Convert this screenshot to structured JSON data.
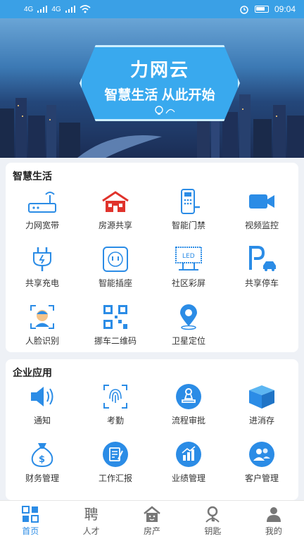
{
  "status_bar": {
    "signal_1": "4G",
    "signal_2": "4G",
    "time": "09:04"
  },
  "banner": {
    "brand": "力网云",
    "slogan": "智慧生活 从此开始"
  },
  "smart_life": {
    "title": "智慧生活",
    "items": [
      {
        "label": "力网宽带",
        "icon": "router-icon"
      },
      {
        "label": "房源共享",
        "icon": "house-icon"
      },
      {
        "label": "智能门禁",
        "icon": "door-lock-icon"
      },
      {
        "label": "视频监控",
        "icon": "camera-icon"
      },
      {
        "label": "共享充电",
        "icon": "charger-plug-icon"
      },
      {
        "label": "智能插座",
        "icon": "socket-icon"
      },
      {
        "label": "社区彩屏",
        "icon": "led-screen-icon"
      },
      {
        "label": "共享停车",
        "icon": "parking-icon"
      },
      {
        "label": "人脸识别",
        "icon": "face-scan-icon"
      },
      {
        "label": "挪车二维码",
        "icon": "qr-code-icon"
      },
      {
        "label": "卫星定位",
        "icon": "location-pin-icon"
      }
    ]
  },
  "enterprise": {
    "title": "企业应用",
    "items": [
      {
        "label": "通知",
        "icon": "speaker-icon"
      },
      {
        "label": "考勤",
        "icon": "fingerprint-icon"
      },
      {
        "label": "流程审批",
        "icon": "stamp-icon"
      },
      {
        "label": "进消存",
        "icon": "box-icon"
      },
      {
        "label": "财务管理",
        "icon": "money-bag-icon"
      },
      {
        "label": "工作汇报",
        "icon": "report-icon"
      },
      {
        "label": "业绩管理",
        "icon": "chart-icon"
      },
      {
        "label": "客户管理",
        "icon": "customers-icon"
      }
    ]
  },
  "tabs": [
    {
      "label": "首页",
      "icon": "home-icon",
      "active": true
    },
    {
      "label": "人才",
      "icon": "recruit-icon",
      "glyph": "聘"
    },
    {
      "label": "房产",
      "icon": "property-icon"
    },
    {
      "label": "钥匙",
      "icon": "key-icon"
    },
    {
      "label": "我的",
      "icon": "profile-icon"
    }
  ],
  "colors": {
    "primary": "#2b8ce6",
    "accent_red": "#e0332c",
    "status_bar": "#3aa0e6"
  }
}
